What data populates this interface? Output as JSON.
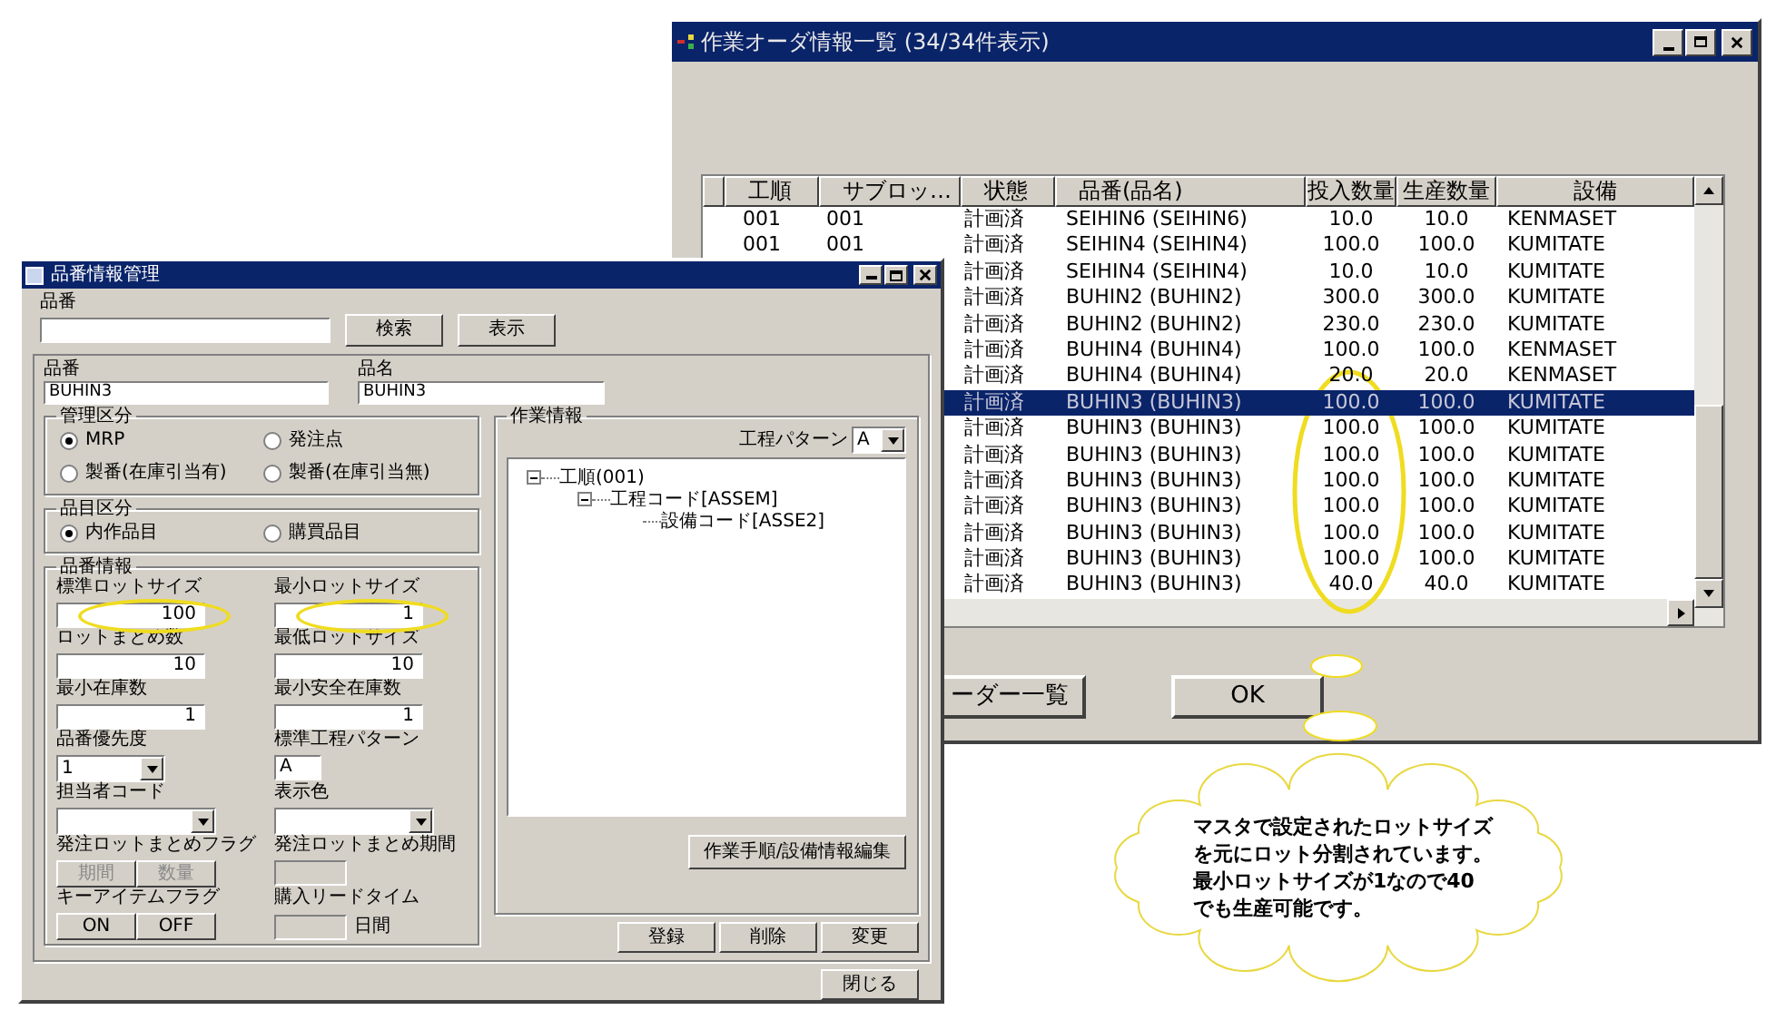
{
  "order_window": {
    "title": "作業オーダ情報一覧 (34/34件表示)",
    "columns": [
      "工順",
      "サブロッ…",
      "状態",
      "品番(品名)",
      "投入数量",
      "生産数量",
      "設備"
    ],
    "rows": [
      {
        "order": "001",
        "sub_lot": "001",
        "status": "計画済",
        "item": "SEIHIN6 (SEIHIN6)",
        "input_qty": "10.0",
        "output_qty": "10.0",
        "equipment": "KENMASET",
        "selected": false
      },
      {
        "order": "001",
        "sub_lot": "001",
        "status": "計画済",
        "item": "SEIHIN4 (SEIHIN4)",
        "input_qty": "100.0",
        "output_qty": "100.0",
        "equipment": "KUMITATE",
        "selected": false
      },
      {
        "status": "計画済",
        "item": "SEIHIN4 (SEIHIN4)",
        "input_qty": "10.0",
        "output_qty": "10.0",
        "equipment": "KUMITATE",
        "selected": false
      },
      {
        "status": "計画済",
        "item": "BUHIN2 (BUHIN2)",
        "input_qty": "300.0",
        "output_qty": "300.0",
        "equipment": "KUMITATE",
        "selected": false
      },
      {
        "status": "計画済",
        "item": "BUHIN2 (BUHIN2)",
        "input_qty": "230.0",
        "output_qty": "230.0",
        "equipment": "KUMITATE",
        "selected": false
      },
      {
        "status": "計画済",
        "item": "BUHIN4 (BUHIN4)",
        "input_qty": "100.0",
        "output_qty": "100.0",
        "equipment": "KENMASET",
        "selected": false
      },
      {
        "status": "計画済",
        "item": "BUHIN4 (BUHIN4)",
        "input_qty": "20.0",
        "output_qty": "20.0",
        "equipment": "KENMASET",
        "selected": false
      },
      {
        "status": "計画済",
        "item": "BUHIN3 (BUHIN3)",
        "input_qty": "100.0",
        "output_qty": "100.0",
        "equipment": "KUMITATE",
        "selected": true
      },
      {
        "status": "計画済",
        "item": "BUHIN3 (BUHIN3)",
        "input_qty": "100.0",
        "output_qty": "100.0",
        "equipment": "KUMITATE",
        "selected": false
      },
      {
        "status": "計画済",
        "item": "BUHIN3 (BUHIN3)",
        "input_qty": "100.0",
        "output_qty": "100.0",
        "equipment": "KUMITATE",
        "selected": false
      },
      {
        "status": "計画済",
        "item": "BUHIN3 (BUHIN3)",
        "input_qty": "100.0",
        "output_qty": "100.0",
        "equipment": "KUMITATE",
        "selected": false
      },
      {
        "status": "計画済",
        "item": "BUHIN3 (BUHIN3)",
        "input_qty": "100.0",
        "output_qty": "100.0",
        "equipment": "KUMITATE",
        "selected": false
      },
      {
        "status": "計画済",
        "item": "BUHIN3 (BUHIN3)",
        "input_qty": "100.0",
        "output_qty": "100.0",
        "equipment": "KUMITATE",
        "selected": false
      },
      {
        "status": "計画済",
        "item": "BUHIN3 (BUHIN3)",
        "input_qty": "100.0",
        "output_qty": "100.0",
        "equipment": "KUMITATE",
        "selected": false
      },
      {
        "status": "計画済",
        "item": "BUHIN3 (BUHIN3)",
        "input_qty": "40.0",
        "output_qty": "40.0",
        "equipment": "KUMITATE",
        "selected": false
      }
    ],
    "buttons": [
      "ーダー一覧",
      "OK"
    ]
  },
  "item_window": {
    "title": "品番情報管理",
    "search_label": "品番",
    "search_buttons": [
      "検索",
      "表示"
    ],
    "item_code": {
      "label": "品番",
      "value": "BUHIN3"
    },
    "item_name": {
      "label": "品名",
      "value": "BUHIN3"
    },
    "management": {
      "legend": "管理区分",
      "options": [
        {
          "label": "MRP",
          "selected": true
        },
        {
          "label": "発注点",
          "selected": false
        },
        {
          "label": "製番(在庫引当有)",
          "selected": false
        },
        {
          "label": "製番(在庫引当無)",
          "selected": false
        }
      ]
    },
    "category": {
      "legend": "品目区分",
      "options": [
        {
          "label": "内作品目",
          "selected": true
        },
        {
          "label": "購買品目",
          "selected": false
        }
      ]
    },
    "info": {
      "legend": "品番情報",
      "fields": [
        {
          "kind": "number",
          "label": "標準ロットサイズ",
          "value": "100",
          "circled": true
        },
        {
          "kind": "number",
          "label": "最小ロットサイズ",
          "value": "1",
          "circled": true
        },
        {
          "kind": "number",
          "label": "ロットまとめ数",
          "value": "10"
        },
        {
          "kind": "number",
          "label": "最低ロットサイズ",
          "value": "10"
        },
        {
          "kind": "number",
          "label": "最小在庫数",
          "value": "1"
        },
        {
          "kind": "number",
          "label": "最小安全在庫数",
          "value": "1"
        },
        {
          "kind": "select",
          "label": "品番優先度",
          "value": "1"
        },
        {
          "kind": "text",
          "label": "標準工程パターン",
          "value": "A",
          "disabled": false
        },
        {
          "kind": "select",
          "label": "担当者コード"
        },
        {
          "kind": "select",
          "label": "表示色"
        },
        {
          "kind": "toggle",
          "label": "発注ロットまとめフラグ",
          "options": [
            {
              "label": "期間",
              "disabled": true
            },
            {
              "label": "数量",
              "disabled": true
            }
          ]
        },
        {
          "kind": "text",
          "label": "発注ロットまとめ期間",
          "disabled": true
        },
        {
          "kind": "toggle",
          "label": "キーアイテムフラグ",
          "options": [
            {
              "label": "ON",
              "disabled": false
            },
            {
              "label": "OFF",
              "disabled": false
            }
          ]
        },
        {
          "kind": "text",
          "label": "購入リードタイム",
          "disabled": true,
          "suffix": "日間"
        }
      ]
    },
    "work": {
      "legend": "作業情報",
      "pattern_label": "工程パターン",
      "pattern_value": "A",
      "tree": [
        {
          "label": "工順(001)",
          "expanded": true,
          "children": [
            {
              "label": "工程コード[ASSEM]",
              "expanded": true,
              "children": [
                {
                  "label": "設備コード[ASSE2]"
                }
              ]
            }
          ]
        }
      ],
      "edit_button": "作業手順/設備情報編集"
    },
    "actions": [
      "登録",
      "削除",
      "変更"
    ],
    "close_button": "閉じる"
  },
  "callout": {
    "lines": [
      "マスタで設定されたロットサイズ",
      "を元にロット分割されています。",
      "最小ロットサイズが1なので40",
      "でも生産可能です。"
    ]
  }
}
